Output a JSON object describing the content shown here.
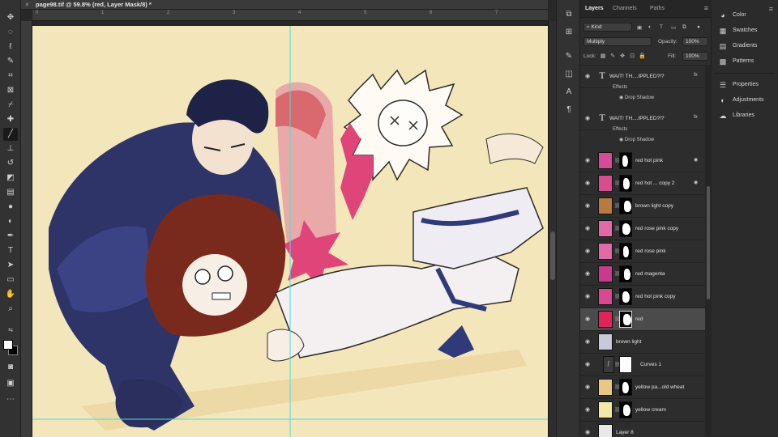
{
  "document": {
    "tab_title": "page98.tif @ 59.8% (red, Layer Mask/8) *",
    "close_glyph": "×"
  },
  "rulers": {
    "horizontal": [
      "0",
      "1",
      "2",
      "3",
      "4",
      "5",
      "6",
      "7"
    ]
  },
  "tools": [
    "move-tool",
    "marquee-tool",
    "lasso-tool",
    "quick-select-tool",
    "crop-tool",
    "frame-tool",
    "eyedropper-tool",
    "healing-brush-tool",
    "brush-tool",
    "clone-stamp-tool",
    "history-brush-tool",
    "eraser-tool",
    "gradient-tool",
    "blur-tool",
    "dodge-tool",
    "pen-tool",
    "type-tool",
    "path-select-tool",
    "rectangle-tool",
    "hand-tool",
    "zoom-tool"
  ],
  "layers_panel": {
    "tabs": [
      "Layers",
      "Channels",
      "Paths"
    ],
    "active_tab": "Layers",
    "filter_kind": "Kind",
    "blend_mode": "Multiply",
    "opacity_label": "Opacity:",
    "opacity_value": "100%",
    "lock_label": "Lock:",
    "fill_label": "Fill:",
    "fill_value": "100%",
    "effects_label": "Effects",
    "drop_shadow_label": "Drop Shadow",
    "layers": [
      {
        "name": "WAIT! TH....IPPLED?!?",
        "type": "text",
        "fx": "fx"
      },
      {
        "name": "WAIT! TH....IPPLED?!?",
        "type": "text",
        "fx": "fx"
      },
      {
        "name": "red hot pink",
        "thumb": "#d64a9a",
        "selected": false
      },
      {
        "name": "red hot ... copy 2",
        "thumb": "#d94d8f",
        "selected": false
      },
      {
        "name": "brown light copy",
        "thumb": "#b97a3f",
        "selected": false
      },
      {
        "name": "red rose pink copy",
        "thumb": "#e36aa7",
        "selected": false
      },
      {
        "name": "red rose pink",
        "thumb": "#e26aa5",
        "selected": false
      },
      {
        "name": "red magenta",
        "thumb": "#c93a8e",
        "selected": false
      },
      {
        "name": "red hot pink copy",
        "thumb": "#d94890",
        "selected": false
      },
      {
        "name": "red",
        "thumb": "#e0235c",
        "selected": true
      },
      {
        "name": "brown light",
        "thumb": "#c9c9d8",
        "selected": false
      },
      {
        "name": "Curves 1",
        "thumb": "#3a3a3a",
        "selected": false
      },
      {
        "name": "yellow pa...old wheat",
        "thumb": "#e8c884",
        "selected": false
      },
      {
        "name": "yellow cream",
        "thumb": "#f1e9a5",
        "selected": false
      },
      {
        "name": "Layer 8",
        "thumb": "#e8e8e8",
        "selected": false
      }
    ]
  },
  "side_panels": {
    "group1": [
      "Color",
      "Swatches",
      "Gradients",
      "Patterns"
    ],
    "group2": [
      "Properties",
      "Adjustments",
      "Libraries"
    ]
  },
  "colors": {
    "canvas_bg": "#f2e4b4",
    "guide": "#46e0e0",
    "navy": "#2a2f5e",
    "hair": "#7a2a1c",
    "pink": "#e0457a",
    "selected_layer": "#4b4b4b"
  }
}
